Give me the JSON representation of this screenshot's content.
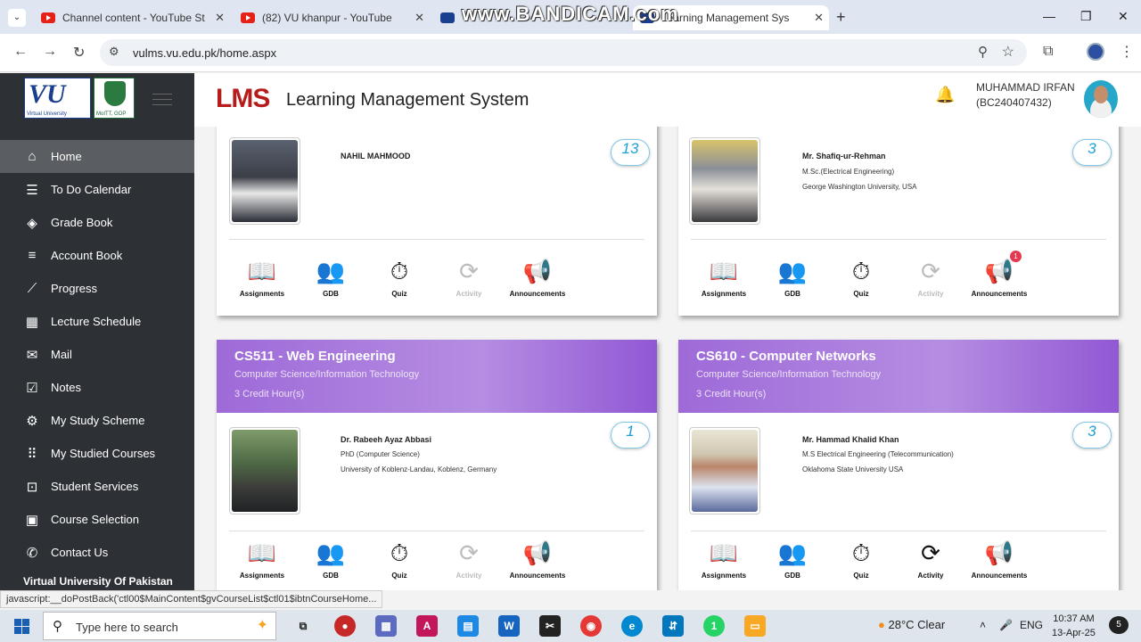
{
  "browser": {
    "tabs": [
      {
        "title": "Channel content - YouTube Stu",
        "icon": "youtube-icon"
      },
      {
        "title": "(82) VU khanpur - YouTube",
        "icon": "youtube-icon"
      },
      {
        "title": "V",
        "icon": "vu-icon"
      },
      {
        "title": "Learning Management Sys",
        "icon": "lms-icon"
      }
    ],
    "url": "vulms.vu.edu.pk/home.aspx",
    "watermark": "www.BANDICAM.com"
  },
  "sidebar": {
    "logo_text": "VU",
    "logo_sub": "Virtual University",
    "gov_sub": "MoITT, GOP",
    "items": [
      {
        "label": "Home",
        "icon": "home-icon"
      },
      {
        "label": "To Do Calendar",
        "icon": "list-icon"
      },
      {
        "label": "Grade Book",
        "icon": "layers-icon"
      },
      {
        "label": "Account Book",
        "icon": "sliders-icon"
      },
      {
        "label": "Progress",
        "icon": "chart-icon"
      },
      {
        "label": "Lecture Schedule",
        "icon": "calendar-icon"
      },
      {
        "label": "Mail",
        "icon": "mail-icon"
      },
      {
        "label": "Notes",
        "icon": "checklist-icon"
      },
      {
        "label": "My Study Scheme",
        "icon": "gear-icon"
      },
      {
        "label": "My Studied Courses",
        "icon": "grid-icon"
      },
      {
        "label": "Student Services",
        "icon": "bag-icon"
      },
      {
        "label": "Course Selection",
        "icon": "calendar-check-icon"
      },
      {
        "label": "Contact Us",
        "icon": "phone-icon"
      }
    ],
    "footer": "Virtual University Of Pakistan"
  },
  "header": {
    "logo": "LMS",
    "title": "Learning Management System",
    "user_name": "MUHAMMAD IRFAN",
    "user_id": "(BC240407432)"
  },
  "activity_labels": {
    "assignments": "Assignments",
    "gdb": "GDB",
    "quiz": "Quiz",
    "activity": "Activity",
    "announcements": "Announcements"
  },
  "courses": [
    {
      "name": "",
      "dept": "",
      "credits": "",
      "teacher": "NAHIL MAHMOOD",
      "degree": "",
      "university": "",
      "count": "13",
      "activity_enabled": false,
      "announcement_badge": ""
    },
    {
      "name": "",
      "dept": "",
      "credits": "",
      "teacher": "Mr. Shafiq-ur-Rehman",
      "degree": "M.Sc.(Electrical Engineering)",
      "university": "George Washington University, USA",
      "count": "3",
      "activity_enabled": false,
      "announcement_badge": "1"
    },
    {
      "name": "CS511 - Web Engineering",
      "dept": "Computer Science/Information Technology",
      "credits": "3 Credit Hour(s)",
      "teacher": "Dr. Rabeeh Ayaz Abbasi",
      "degree": "PhD (Computer Science)",
      "university": "University of Koblenz-Landau, Koblenz, Germany",
      "count": "1",
      "activity_enabled": false,
      "announcement_badge": ""
    },
    {
      "name": "CS610 - Computer Networks",
      "dept": "Computer Science/Information Technology",
      "credits": "3 Credit Hour(s)",
      "teacher": "Mr. Hammad Khalid Khan",
      "degree": "M.S Electrical Engineering (Telecommunication)",
      "university": "Oklahoma State University USA",
      "count": "3",
      "activity_enabled": true,
      "announcement_badge": ""
    }
  ],
  "status_url": "javascript:__doPostBack('ctl00$MainContent$gvCourseList$ctl01$ibtnCourseHome...",
  "taskbar": {
    "search_placeholder": "Type here to search",
    "weather": "28°C  Clear",
    "language": "ENG",
    "time": "10:37 AM",
    "date": "13-Apr-25",
    "notifications": "5",
    "whatsapp_badge": "1"
  }
}
